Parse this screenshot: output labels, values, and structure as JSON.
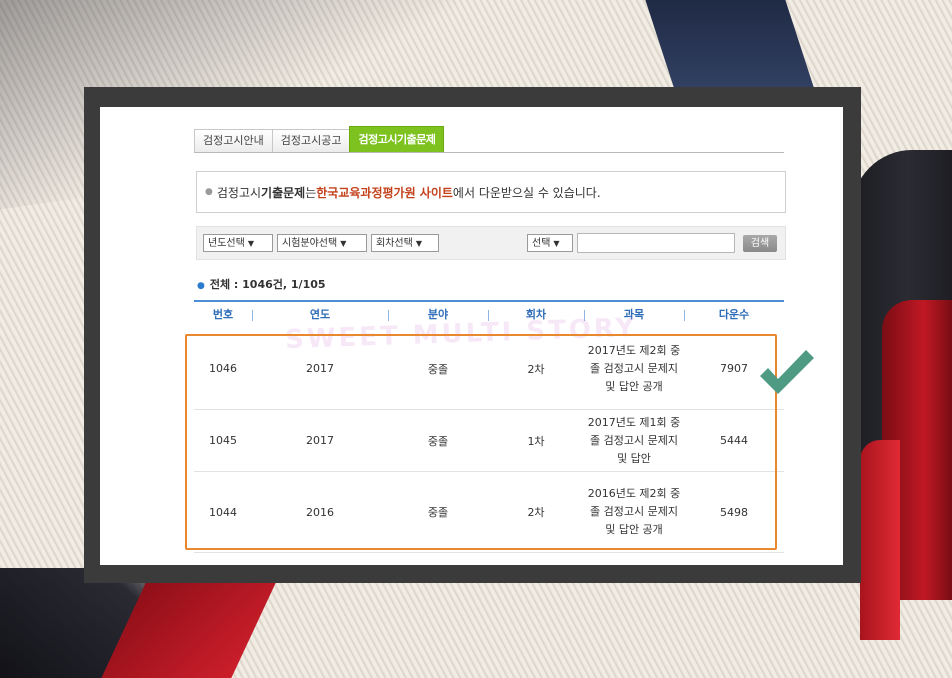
{
  "tabs": [
    {
      "label": "검정고시안내",
      "active": false
    },
    {
      "label": "검정고시공고",
      "active": false
    },
    {
      "label": "검정고시기출문제",
      "active": true
    }
  ],
  "notice": {
    "prefix": "검정고시 ",
    "strong": "기출문제",
    "middle": "는 ",
    "link": "한국교육과정평가원 사이트",
    "suffix": "에서 다운받으실 수 있습니다."
  },
  "filters": {
    "year": "년도선택",
    "field": "시험분야선택",
    "round": "회차선택",
    "search_type": "선택",
    "search_value": "",
    "search_button": "검색"
  },
  "summary": "전체 : 1046건, 1/105",
  "table": {
    "headers": [
      "번호",
      "연도",
      "분야",
      "회차",
      "과목",
      "다운수"
    ],
    "rows": [
      {
        "no": "1046",
        "year": "2017",
        "field": "중졸",
        "round": "2차",
        "subject": "2017년도 제2회 중졸 검정고시 문제지 및 답안 공개",
        "downloads": "7907"
      },
      {
        "no": "1045",
        "year": "2017",
        "field": "중졸",
        "round": "1차",
        "subject": "2017년도 제1회 중졸 검정고시 문제지 및 답안",
        "downloads": "5444"
      },
      {
        "no": "1044",
        "year": "2016",
        "field": "중졸",
        "round": "2차",
        "subject": "2016년도 제2회 중졸 검정고시 문제지 및 답안 공개",
        "downloads": "5498"
      }
    ]
  },
  "watermark": "SWEET MULTI STORY",
  "colors": {
    "active_tab": "#7dc21e",
    "link": "#c4421b",
    "table_header": "#2f6db8",
    "highlight": "#e8882f",
    "check": "#4f9a83"
  },
  "icons": {
    "check": "check-icon",
    "bullet": "bullet-icon",
    "dropdown": "chevron-down-icon"
  }
}
